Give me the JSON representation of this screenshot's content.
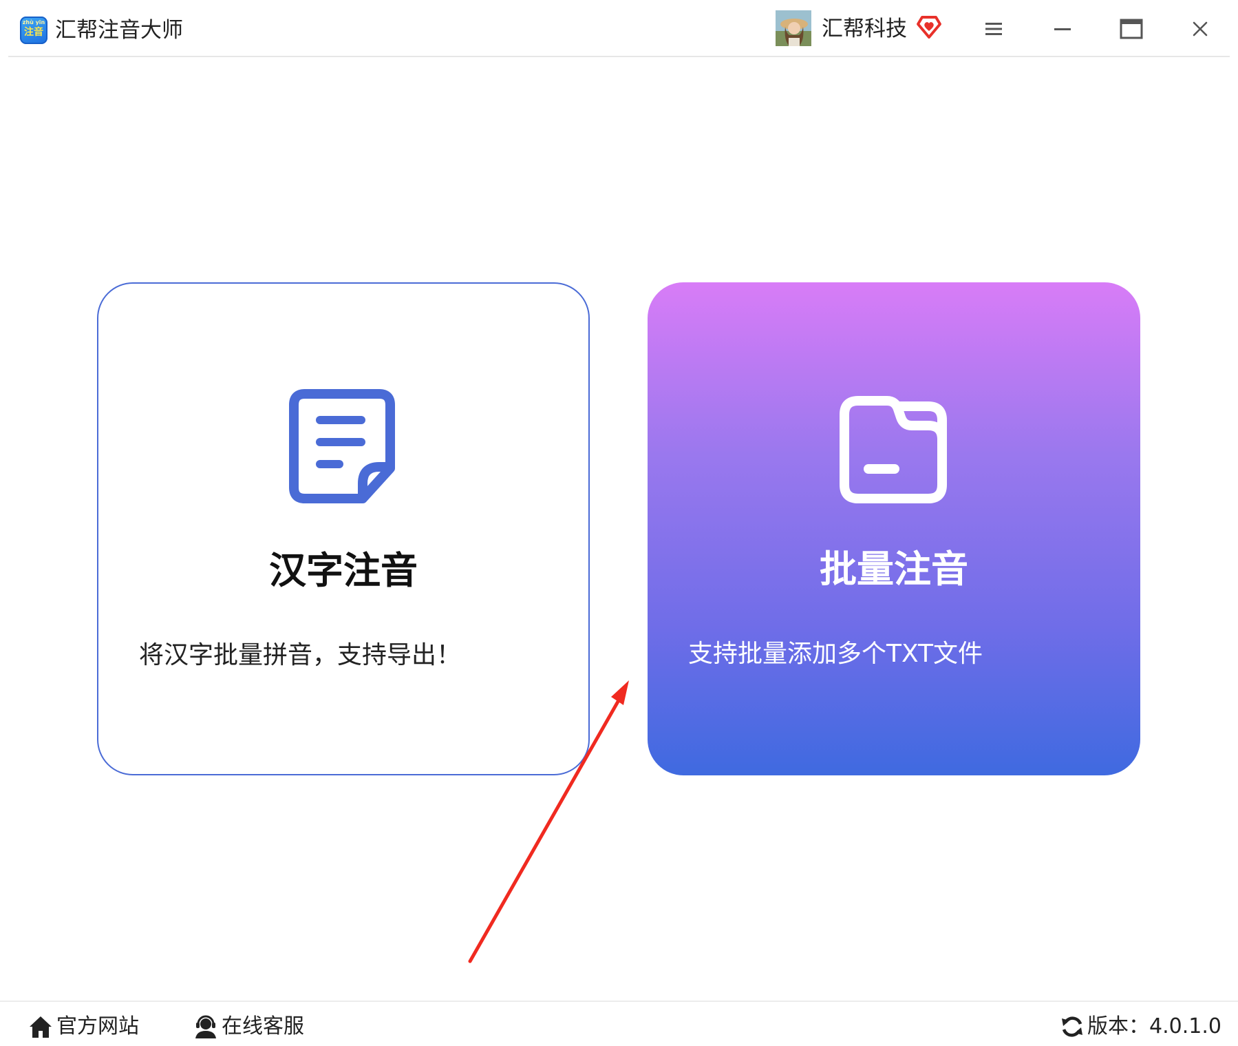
{
  "app": {
    "title": "汇帮注音大师",
    "logo_pinyin": "zhù yīn",
    "logo_text": "注音"
  },
  "user": {
    "name": "汇帮科技",
    "vip_icon": "diamond-heart-icon"
  },
  "window_controls": {
    "menu_icon": "hamburger-icon",
    "minimize_icon": "minimize-icon",
    "maximize_icon": "maximize-icon",
    "close_icon": "close-icon"
  },
  "cards": [
    {
      "id": "single",
      "icon": "document-icon",
      "title": "汉字注音",
      "description": "将汉字批量拼音，支持导出！"
    },
    {
      "id": "batch",
      "icon": "folder-icon",
      "title": "批量注音",
      "description": "支持批量添加多个TXT文件"
    }
  ],
  "footer": {
    "website": {
      "label": "官方网站",
      "icon": "home-icon"
    },
    "service": {
      "label": "在线客服",
      "icon": "headset-user-icon"
    },
    "version": {
      "label": "版本：4.0.1.0",
      "icon": "refresh-icon"
    }
  },
  "colors": {
    "accent_blue": "#4a6bd6",
    "card_gradient_top": "#d87cf7",
    "card_gradient_bottom": "#3f6ae0",
    "annotation_red": "#f02a20",
    "vip_red": "#e8312a"
  }
}
